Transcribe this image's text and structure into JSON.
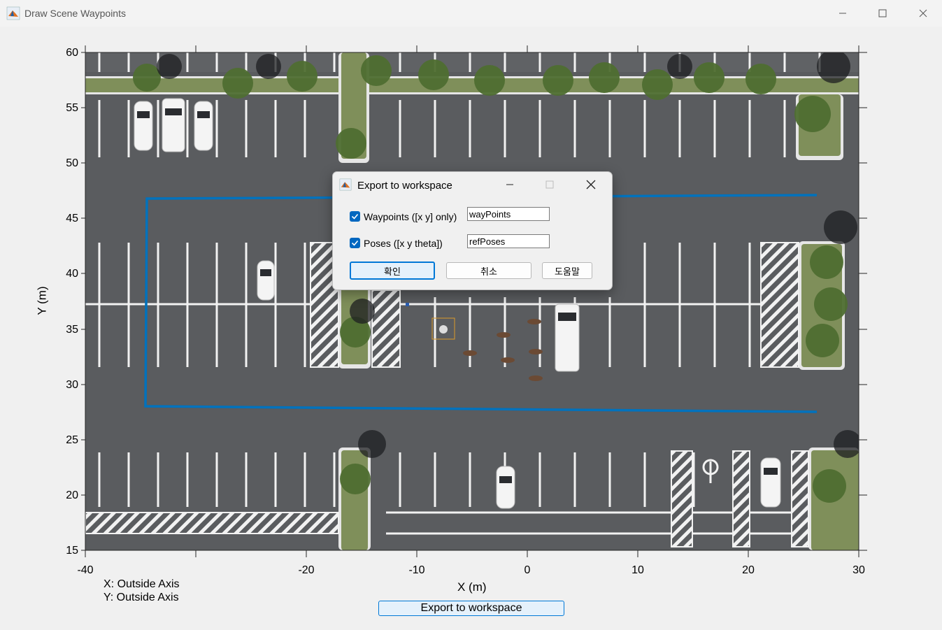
{
  "window": {
    "title": "Draw Scene Waypoints"
  },
  "axes": {
    "y_ticks": [
      "60",
      "55",
      "50",
      "45",
      "40",
      "35",
      "30",
      "25",
      "20",
      "15"
    ],
    "x_ticks": [
      "-40",
      "-20",
      "-10",
      "0",
      "10",
      "20",
      "30"
    ],
    "xlabel": "X (m)",
    "ylabel": "Y (m)",
    "xlim": [
      -40,
      30
    ],
    "ylim": [
      15,
      60
    ]
  },
  "readout": {
    "x": "X: Outside Axis",
    "y": "Y: Outside Axis"
  },
  "export_button": "Export to workspace",
  "dialog": {
    "title": "Export to workspace",
    "waypoints": {
      "label": "Waypoints ([x y] only)",
      "checked": true,
      "value": "wayPoints"
    },
    "poses": {
      "label": "Poses ([x y theta])",
      "checked": true,
      "value": "refPoses"
    },
    "ok": "확인",
    "cancel": "취소",
    "help": "도움말"
  },
  "colors": {
    "path": "#0072bd",
    "accent": "#0078d7",
    "asphalt": "#595b5e",
    "grass": "#7f8f5a"
  }
}
